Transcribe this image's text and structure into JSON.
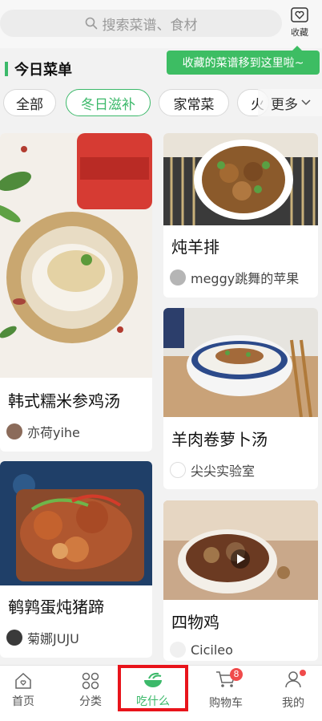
{
  "header": {
    "search_placeholder": "搜索菜谱、食材",
    "favorites_label": "收藏",
    "tooltip": "收藏的菜谱移到这里啦~"
  },
  "section": {
    "title": "今日菜单"
  },
  "chips": [
    {
      "label": "全部",
      "active": false
    },
    {
      "label": "冬日滋补",
      "active": true
    },
    {
      "label": "家常菜",
      "active": false
    },
    {
      "label": "火",
      "active": false
    }
  ],
  "more_label": "更多",
  "cards_left": [
    {
      "title": "韩式糯米参鸡汤",
      "author": "亦荷yihe"
    },
    {
      "title": "鹌鹑蛋炖猪蹄",
      "author": "菊娜JUJU"
    }
  ],
  "cards_right": [
    {
      "title": "炖羊排",
      "author": "meggy跳舞的苹果"
    },
    {
      "title": "羊肉卷萝卜汤",
      "author": "尖尖实验室"
    },
    {
      "title": "四物鸡",
      "author": "Cicileo"
    }
  ],
  "nav": [
    {
      "label": "首页",
      "icon": "home-icon"
    },
    {
      "label": "分类",
      "icon": "grid-icon"
    },
    {
      "label": "吃什么",
      "icon": "bowl-icon",
      "active": true
    },
    {
      "label": "购物车",
      "icon": "cart-icon",
      "badge": "8"
    },
    {
      "label": "我的",
      "icon": "user-icon"
    }
  ],
  "colors": {
    "accent": "#3cb96a",
    "badge": "#f04b4b",
    "highlight": "#e8141b"
  }
}
